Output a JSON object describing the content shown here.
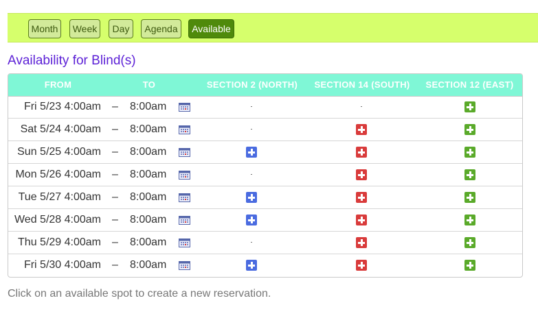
{
  "toolbar": {
    "tabs": [
      {
        "label": "Month",
        "active": false
      },
      {
        "label": "Week",
        "active": false
      },
      {
        "label": "Day",
        "active": false
      },
      {
        "label": "Agenda",
        "active": false
      },
      {
        "label": "Available",
        "active": true
      }
    ]
  },
  "heading": "Availability for Blind(s)",
  "table": {
    "columns": [
      "FROM",
      "TO",
      "SECTION 2 (NORTH)",
      "SECTION 14 (SOUTH)",
      "SECTION 12 (EAST)"
    ],
    "rows": [
      {
        "from": "Fri 5/23 4:00am",
        "sep": "–",
        "to": "8:00am",
        "sections": [
          "unavailable",
          "unavailable",
          "available"
        ]
      },
      {
        "from": "Sat 5/24 4:00am",
        "sep": "–",
        "to": "8:00am",
        "sections": [
          "unavailable",
          "reserved",
          "available"
        ]
      },
      {
        "from": "Sun 5/25 4:00am",
        "sep": "–",
        "to": "8:00am",
        "sections": [
          "open",
          "reserved",
          "available"
        ]
      },
      {
        "from": "Mon 5/26 4:00am",
        "sep": "–",
        "to": "8:00am",
        "sections": [
          "unavailable",
          "reserved",
          "available"
        ]
      },
      {
        "from": "Tue 5/27 4:00am",
        "sep": "–",
        "to": "8:00am",
        "sections": [
          "open",
          "reserved",
          "available"
        ]
      },
      {
        "from": "Wed 5/28 4:00am",
        "sep": "–",
        "to": "8:00am",
        "sections": [
          "open",
          "reserved",
          "available"
        ]
      },
      {
        "from": "Thu 5/29 4:00am",
        "sep": "–",
        "to": "8:00am",
        "sections": [
          "unavailable",
          "reserved",
          "available"
        ]
      },
      {
        "from": "Fri 5/30 4:00am",
        "sep": "–",
        "to": "8:00am",
        "sections": [
          "open",
          "reserved",
          "available"
        ]
      }
    ]
  },
  "colors": {
    "open": "#4a6be0",
    "reserved": "#d93b3b",
    "available": "#5aaa2a",
    "header_bg": "#7ff7d6",
    "toolbar_bg": "#d6ff6c",
    "heading": "#5b1fd6"
  },
  "icons": {
    "calendar": "calendar-icon",
    "slot": "plus-icon"
  },
  "footer": "Click on an available spot to create a new reservation."
}
